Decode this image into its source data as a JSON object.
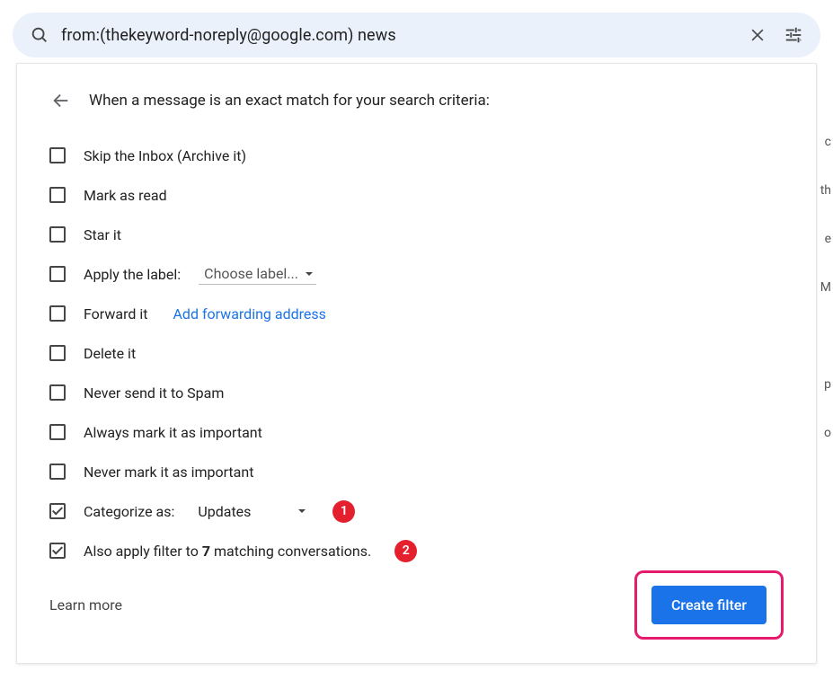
{
  "search": {
    "query": "from:(thekeyword-noreply@google.com) news"
  },
  "panel": {
    "title": "When a message is an exact match for your search criteria:"
  },
  "options": {
    "skip_inbox": "Skip the Inbox (Archive it)",
    "mark_read": "Mark as read",
    "star": "Star it",
    "apply_label": "Apply the label:",
    "apply_label_select": "Choose label...",
    "forward": "Forward it",
    "forward_link": "Add forwarding address",
    "delete": "Delete it",
    "never_spam": "Never send it to Spam",
    "always_important": "Always mark it as important",
    "never_important": "Never mark it as important",
    "categorize": "Categorize as:",
    "categorize_select": "Updates",
    "also_apply_prefix": "Also apply filter to ",
    "also_apply_count": "7",
    "also_apply_suffix": " matching conversations."
  },
  "annotations": {
    "badge1": "1",
    "badge2": "2"
  },
  "footer": {
    "learn_more": "Learn more",
    "create_filter": "Create filter"
  },
  "bg": {
    "h1": "c",
    "h2": "th",
    "h3": "e",
    "h4": "M",
    "h5": "p",
    "h6": "o"
  }
}
